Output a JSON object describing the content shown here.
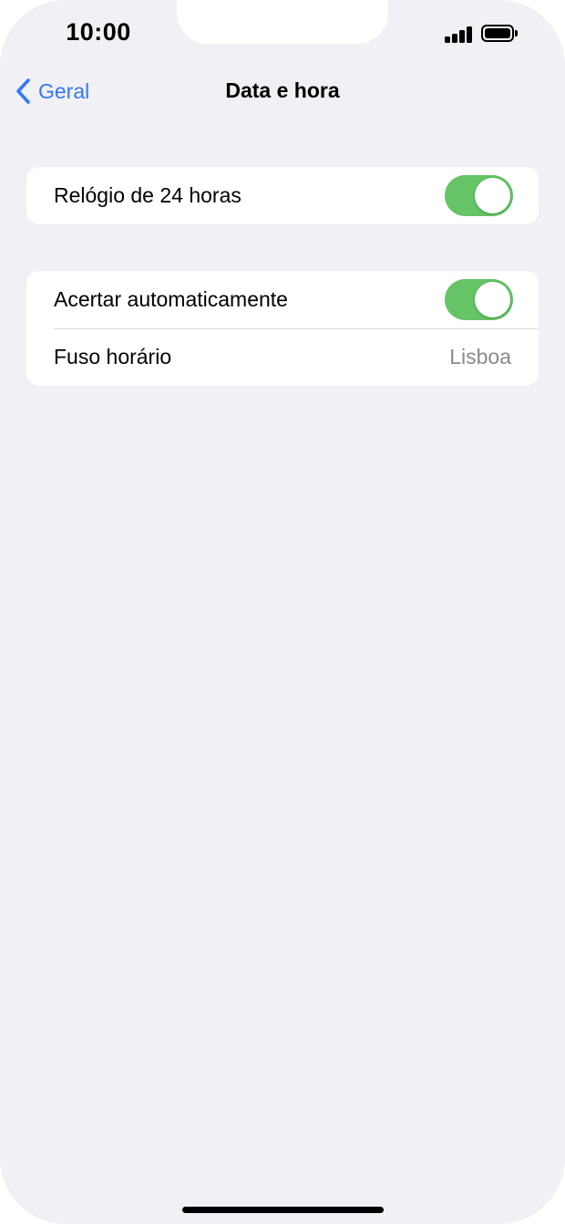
{
  "status_bar": {
    "time": "10:00",
    "signal_icon": "cellular-signal-icon",
    "battery_icon": "battery-icon"
  },
  "nav": {
    "back_label": "Geral",
    "back_icon": "chevron-left-icon",
    "title": "Data e hora"
  },
  "groups": [
    {
      "rows": [
        {
          "label": "Relógio de 24 horas",
          "type": "toggle",
          "on": true
        }
      ]
    },
    {
      "rows": [
        {
          "label": "Acertar automaticamente",
          "type": "toggle",
          "on": true
        },
        {
          "label": "Fuso horário",
          "type": "value",
          "value": "Lisboa"
        }
      ]
    }
  ],
  "colors": {
    "accent": "#3478f6",
    "toggle_on": "#65c466",
    "background": "#f0f0f5",
    "secondary_text": "#8a8a8e"
  }
}
